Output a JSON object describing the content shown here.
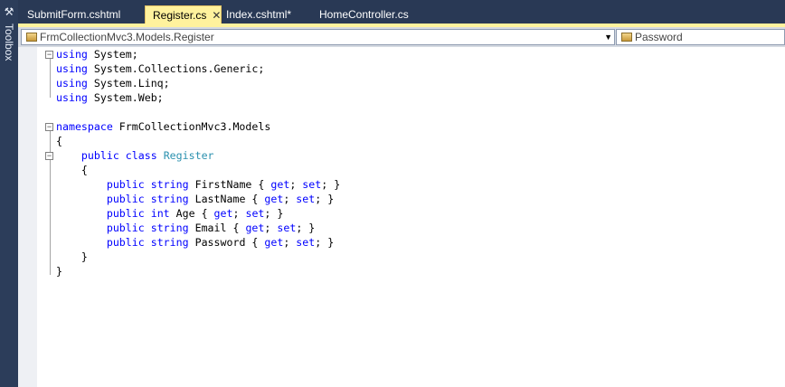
{
  "toolbox": {
    "label": "Toolbox"
  },
  "tabs": [
    {
      "label": "SubmitForm.cshtml",
      "active": false
    },
    {
      "label": "Register.cs",
      "active": true,
      "close": "✕"
    },
    {
      "label": "Index.cshtml*",
      "active": false
    },
    {
      "label": "HomeController.cs",
      "active": false
    }
  ],
  "nav": {
    "type_selector": "FrmCollectionMvc3.Models.Register",
    "member_selector": "Password"
  },
  "colors": {
    "keyword": "#0000ff",
    "type": "#2b91af",
    "active_tab": "#fff29d"
  },
  "code": [
    [
      {
        "t": "using",
        "c": "kw"
      },
      {
        "t": " System;"
      }
    ],
    [
      {
        "t": "using",
        "c": "kw"
      },
      {
        "t": " System.Collections.Generic;"
      }
    ],
    [
      {
        "t": "using",
        "c": "kw"
      },
      {
        "t": " System.Linq;"
      }
    ],
    [
      {
        "t": "using",
        "c": "kw"
      },
      {
        "t": " System.Web;"
      }
    ],
    [],
    [
      {
        "t": "namespace",
        "c": "kw"
      },
      {
        "t": " FrmCollectionMvc3.Models"
      }
    ],
    [
      {
        "t": "{"
      }
    ],
    [
      {
        "t": "    "
      },
      {
        "t": "public",
        "c": "kw"
      },
      {
        "t": " "
      },
      {
        "t": "class",
        "c": "kw"
      },
      {
        "t": " "
      },
      {
        "t": "Register",
        "c": "ty"
      }
    ],
    [
      {
        "t": "    {"
      }
    ],
    [
      {
        "t": "        "
      },
      {
        "t": "public",
        "c": "kw"
      },
      {
        "t": " "
      },
      {
        "t": "string",
        "c": "kw"
      },
      {
        "t": " FirstName { "
      },
      {
        "t": "get",
        "c": "kw"
      },
      {
        "t": "; "
      },
      {
        "t": "set",
        "c": "kw"
      },
      {
        "t": "; }"
      }
    ],
    [
      {
        "t": "        "
      },
      {
        "t": "public",
        "c": "kw"
      },
      {
        "t": " "
      },
      {
        "t": "string",
        "c": "kw"
      },
      {
        "t": " LastName { "
      },
      {
        "t": "get",
        "c": "kw"
      },
      {
        "t": "; "
      },
      {
        "t": "set",
        "c": "kw"
      },
      {
        "t": "; }"
      }
    ],
    [
      {
        "t": "        "
      },
      {
        "t": "public",
        "c": "kw"
      },
      {
        "t": " "
      },
      {
        "t": "int",
        "c": "kw"
      },
      {
        "t": " Age { "
      },
      {
        "t": "get",
        "c": "kw"
      },
      {
        "t": "; "
      },
      {
        "t": "set",
        "c": "kw"
      },
      {
        "t": "; }"
      }
    ],
    [
      {
        "t": "        "
      },
      {
        "t": "public",
        "c": "kw"
      },
      {
        "t": " "
      },
      {
        "t": "string",
        "c": "kw"
      },
      {
        "t": " Email { "
      },
      {
        "t": "get",
        "c": "kw"
      },
      {
        "t": "; "
      },
      {
        "t": "set",
        "c": "kw"
      },
      {
        "t": "; }"
      }
    ],
    [
      {
        "t": "        "
      },
      {
        "t": "public",
        "c": "kw"
      },
      {
        "t": " "
      },
      {
        "t": "string",
        "c": "kw"
      },
      {
        "t": " Password { "
      },
      {
        "t": "get",
        "c": "kw"
      },
      {
        "t": "; "
      },
      {
        "t": "set",
        "c": "kw"
      },
      {
        "t": "; }"
      }
    ],
    [
      {
        "t": "    }"
      }
    ],
    [
      {
        "t": "}"
      }
    ]
  ]
}
